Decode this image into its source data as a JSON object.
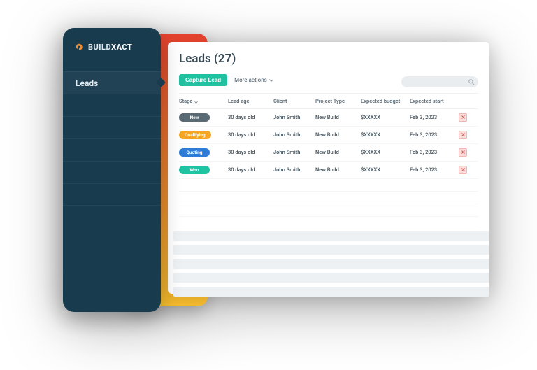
{
  "brand": {
    "name_prefix": "BUILD",
    "name_suffix": "XACT"
  },
  "sidebar": {
    "items": [
      {
        "label": "Leads",
        "active": true
      },
      {
        "label": "",
        "active": false
      },
      {
        "label": "",
        "active": false
      },
      {
        "label": "",
        "active": false
      },
      {
        "label": "",
        "active": false
      },
      {
        "label": "",
        "active": false
      }
    ]
  },
  "header": {
    "title": "Leads (27)"
  },
  "toolbar": {
    "capture_label": "Capture Lead",
    "more_actions_label": "More actions",
    "search_placeholder": ""
  },
  "table": {
    "headers": {
      "stage": "Stage",
      "lead_age": "Lead age",
      "client": "Client",
      "project_type": "Project Type",
      "expected_budget": "Expected budget",
      "expected_start": "Expected start"
    },
    "rows": [
      {
        "stage": "New",
        "stage_class": "stage-new",
        "lead_age": "30 days old",
        "client": "John Smith",
        "project_type": "New Build",
        "expected_budget": "$XXXXX",
        "expected_start": "Feb 3, 2023"
      },
      {
        "stage": "Qualifying",
        "stage_class": "stage-qualifying",
        "lead_age": "30 days old",
        "client": "John Smith",
        "project_type": "New Build",
        "expected_budget": "$XXXXX",
        "expected_start": "Feb 3, 2023"
      },
      {
        "stage": "Quoting",
        "stage_class": "stage-quoting",
        "lead_age": "30 days old",
        "client": "John Smith",
        "project_type": "New Build",
        "expected_budget": "$XXXXX",
        "expected_start": "Feb 3, 2023"
      },
      {
        "stage": "Won",
        "stage_class": "stage-won",
        "lead_age": "30 days old",
        "client": "John Smith",
        "project_type": "New Build",
        "expected_budget": "$XXXXX",
        "expected_start": "Feb 3, 2023"
      }
    ]
  },
  "colors": {
    "brand_accent": "#f08a2d",
    "sidebar_bg": "#183b4e",
    "primary_action": "#1fc1a1",
    "stage_new": "#5a6a74",
    "stage_qualifying": "#f6a623",
    "stage_quoting": "#2e7cd6",
    "stage_won": "#20c4a3",
    "danger": "#d9534f"
  }
}
